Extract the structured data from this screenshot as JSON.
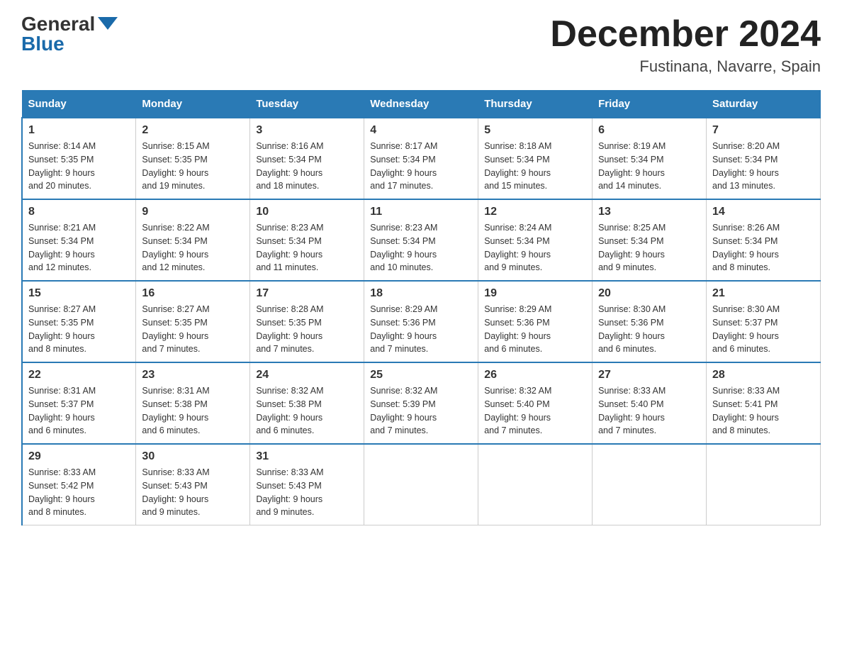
{
  "logo": {
    "general": "General",
    "blue": "Blue"
  },
  "header": {
    "month": "December 2024",
    "location": "Fustinana, Navarre, Spain"
  },
  "days_of_week": [
    "Sunday",
    "Monday",
    "Tuesday",
    "Wednesday",
    "Thursday",
    "Friday",
    "Saturday"
  ],
  "weeks": [
    [
      {
        "day": "1",
        "sunrise": "8:14 AM",
        "sunset": "5:35 PM",
        "daylight": "9 hours and 20 minutes."
      },
      {
        "day": "2",
        "sunrise": "8:15 AM",
        "sunset": "5:35 PM",
        "daylight": "9 hours and 19 minutes."
      },
      {
        "day": "3",
        "sunrise": "8:16 AM",
        "sunset": "5:34 PM",
        "daylight": "9 hours and 18 minutes."
      },
      {
        "day": "4",
        "sunrise": "8:17 AM",
        "sunset": "5:34 PM",
        "daylight": "9 hours and 17 minutes."
      },
      {
        "day": "5",
        "sunrise": "8:18 AM",
        "sunset": "5:34 PM",
        "daylight": "9 hours and 15 minutes."
      },
      {
        "day": "6",
        "sunrise": "8:19 AM",
        "sunset": "5:34 PM",
        "daylight": "9 hours and 14 minutes."
      },
      {
        "day": "7",
        "sunrise": "8:20 AM",
        "sunset": "5:34 PM",
        "daylight": "9 hours and 13 minutes."
      }
    ],
    [
      {
        "day": "8",
        "sunrise": "8:21 AM",
        "sunset": "5:34 PM",
        "daylight": "9 hours and 12 minutes."
      },
      {
        "day": "9",
        "sunrise": "8:22 AM",
        "sunset": "5:34 PM",
        "daylight": "9 hours and 12 minutes."
      },
      {
        "day": "10",
        "sunrise": "8:23 AM",
        "sunset": "5:34 PM",
        "daylight": "9 hours and 11 minutes."
      },
      {
        "day": "11",
        "sunrise": "8:23 AM",
        "sunset": "5:34 PM",
        "daylight": "9 hours and 10 minutes."
      },
      {
        "day": "12",
        "sunrise": "8:24 AM",
        "sunset": "5:34 PM",
        "daylight": "9 hours and 9 minutes."
      },
      {
        "day": "13",
        "sunrise": "8:25 AM",
        "sunset": "5:34 PM",
        "daylight": "9 hours and 9 minutes."
      },
      {
        "day": "14",
        "sunrise": "8:26 AM",
        "sunset": "5:34 PM",
        "daylight": "9 hours and 8 minutes."
      }
    ],
    [
      {
        "day": "15",
        "sunrise": "8:27 AM",
        "sunset": "5:35 PM",
        "daylight": "9 hours and 8 minutes."
      },
      {
        "day": "16",
        "sunrise": "8:27 AM",
        "sunset": "5:35 PM",
        "daylight": "9 hours and 7 minutes."
      },
      {
        "day": "17",
        "sunrise": "8:28 AM",
        "sunset": "5:35 PM",
        "daylight": "9 hours and 7 minutes."
      },
      {
        "day": "18",
        "sunrise": "8:29 AM",
        "sunset": "5:36 PM",
        "daylight": "9 hours and 7 minutes."
      },
      {
        "day": "19",
        "sunrise": "8:29 AM",
        "sunset": "5:36 PM",
        "daylight": "9 hours and 6 minutes."
      },
      {
        "day": "20",
        "sunrise": "8:30 AM",
        "sunset": "5:36 PM",
        "daylight": "9 hours and 6 minutes."
      },
      {
        "day": "21",
        "sunrise": "8:30 AM",
        "sunset": "5:37 PM",
        "daylight": "9 hours and 6 minutes."
      }
    ],
    [
      {
        "day": "22",
        "sunrise": "8:31 AM",
        "sunset": "5:37 PM",
        "daylight": "9 hours and 6 minutes."
      },
      {
        "day": "23",
        "sunrise": "8:31 AM",
        "sunset": "5:38 PM",
        "daylight": "9 hours and 6 minutes."
      },
      {
        "day": "24",
        "sunrise": "8:32 AM",
        "sunset": "5:38 PM",
        "daylight": "9 hours and 6 minutes."
      },
      {
        "day": "25",
        "sunrise": "8:32 AM",
        "sunset": "5:39 PM",
        "daylight": "9 hours and 7 minutes."
      },
      {
        "day": "26",
        "sunrise": "8:32 AM",
        "sunset": "5:40 PM",
        "daylight": "9 hours and 7 minutes."
      },
      {
        "day": "27",
        "sunrise": "8:33 AM",
        "sunset": "5:40 PM",
        "daylight": "9 hours and 7 minutes."
      },
      {
        "day": "28",
        "sunrise": "8:33 AM",
        "sunset": "5:41 PM",
        "daylight": "9 hours and 8 minutes."
      }
    ],
    [
      {
        "day": "29",
        "sunrise": "8:33 AM",
        "sunset": "5:42 PM",
        "daylight": "9 hours and 8 minutes."
      },
      {
        "day": "30",
        "sunrise": "8:33 AM",
        "sunset": "5:43 PM",
        "daylight": "9 hours and 9 minutes."
      },
      {
        "day": "31",
        "sunrise": "8:33 AM",
        "sunset": "5:43 PM",
        "daylight": "9 hours and 9 minutes."
      },
      null,
      null,
      null,
      null
    ]
  ]
}
